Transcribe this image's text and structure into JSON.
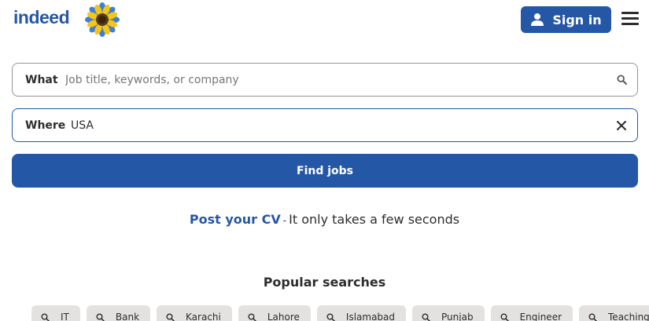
{
  "header": {
    "logo_text": "indeed",
    "sign_in_label": "Sign in",
    "brand_color": "#2557a7"
  },
  "search": {
    "what": {
      "label": "What",
      "value": "",
      "placeholder": "Job title, keywords, or company",
      "icon": "search-icon"
    },
    "where": {
      "label": "Where",
      "value": "USA",
      "placeholder": "",
      "icon": "close-icon"
    },
    "find_button_label": "Find jobs"
  },
  "post_cv": {
    "link_text": "Post your CV",
    "separator": "-",
    "tagline": "It only takes a few seconds"
  },
  "popular": {
    "title": "Popular searches",
    "items": [
      "IT",
      "Bank",
      "Karachi",
      "Lahore",
      "Islamabad",
      "Punjab",
      "Engineer",
      "Teaching"
    ],
    "chip_icon": "search-icon"
  }
}
